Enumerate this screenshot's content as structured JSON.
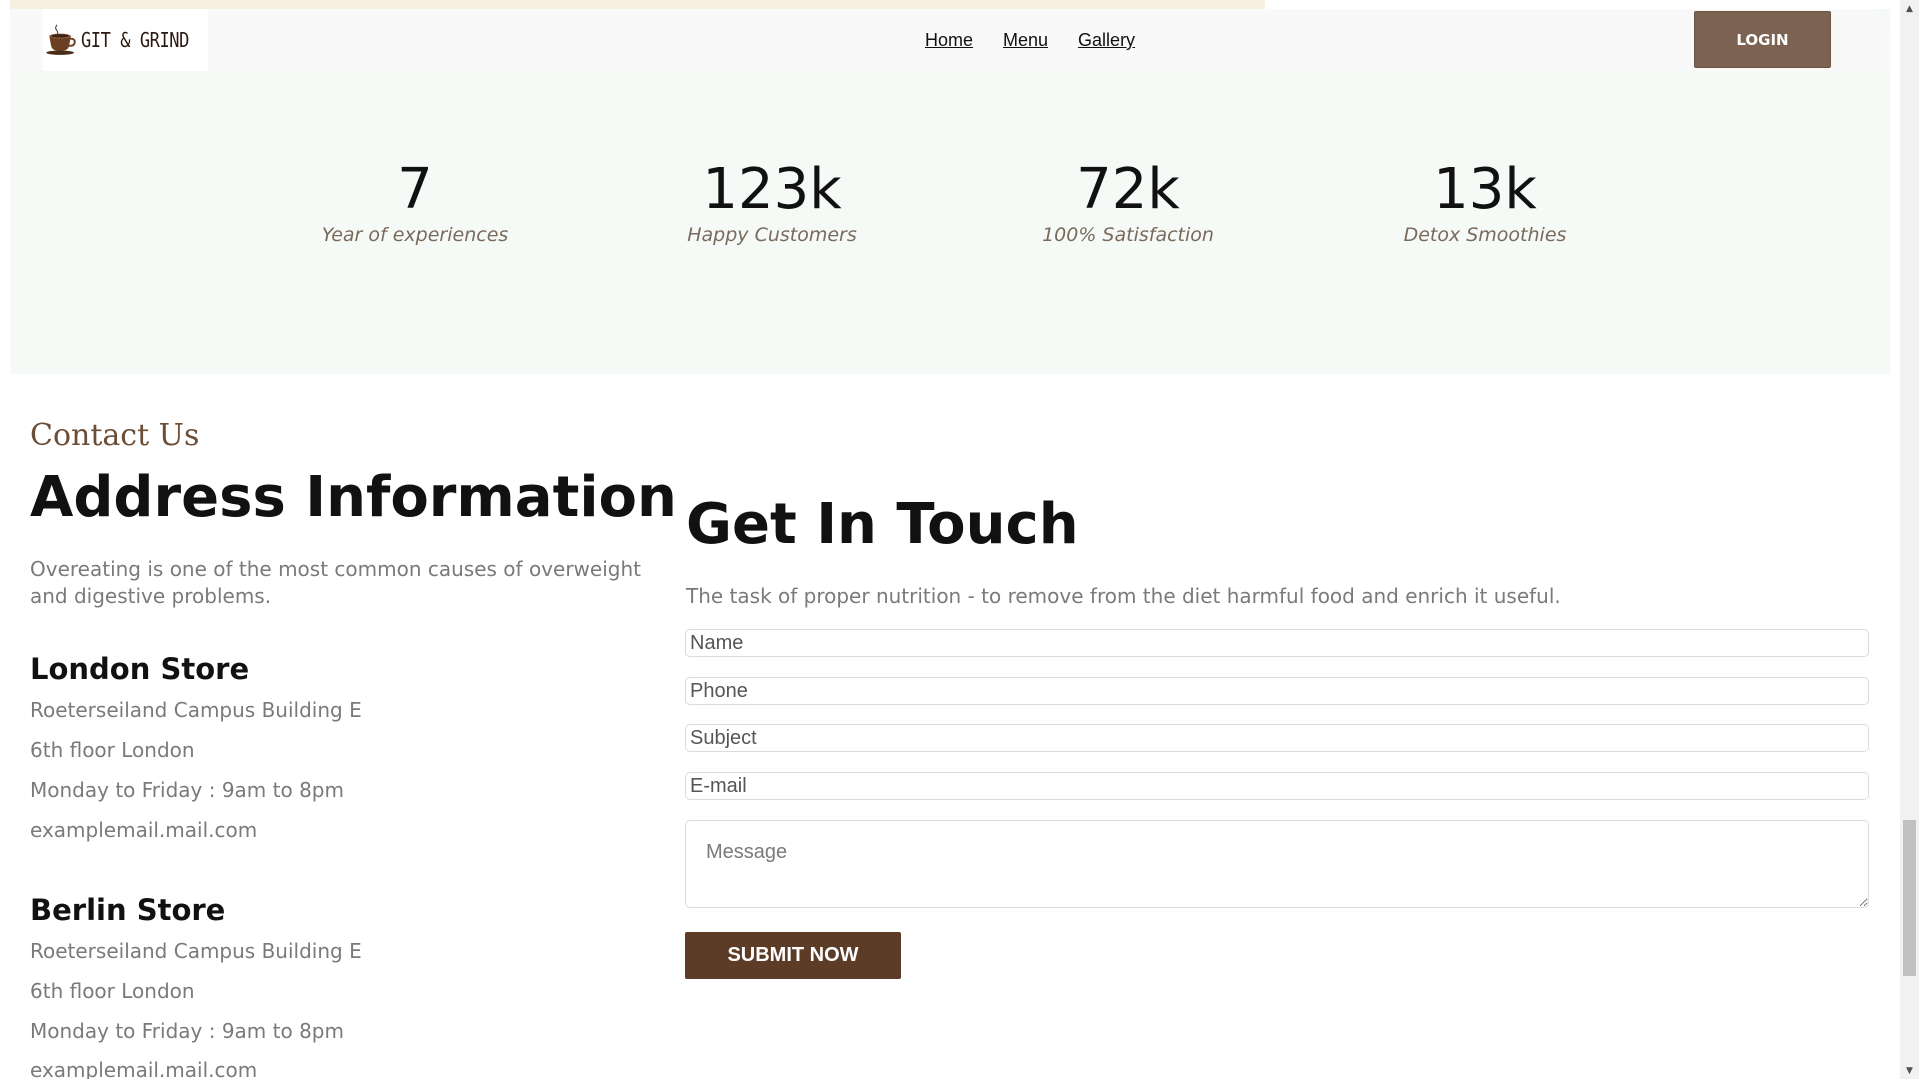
{
  "header": {
    "logo_text": "GIT & GRIND",
    "nav": [
      {
        "label": "Home"
      },
      {
        "label": "Menu"
      },
      {
        "label": "Gallery"
      }
    ],
    "login_label": "LOGIN"
  },
  "stats": [
    {
      "value": "7",
      "label": "Year of experiences"
    },
    {
      "value": "123k",
      "label": "Happy Customers"
    },
    {
      "value": "72k",
      "label": "100% Satisfaction"
    },
    {
      "value": "13k",
      "label": "Detox Smoothies"
    }
  ],
  "contact": {
    "eyebrow": "Contact Us",
    "title": "Address Information",
    "description": "Overeating is one of the most common causes of overweight and digestive problems.",
    "stores": [
      {
        "name": "London Store",
        "address1": "Roeterseiland Campus Building E",
        "address2": "6th floor London",
        "hours": "Monday to Friday : 9am to 8pm",
        "email": "examplemail.mail.com"
      },
      {
        "name": "Berlin Store",
        "address1": "Roeterseiland Campus Building E",
        "address2": "6th floor London",
        "hours": "Monday to Friday : 9am to 8pm",
        "email": "examplemail.mail.com"
      }
    ]
  },
  "form": {
    "title": "Get In Touch",
    "description": "The task of proper nutrition - to remove from the diet harmful food and enrich it useful.",
    "name_placeholder": "Name",
    "phone_placeholder": "Phone",
    "subject_placeholder": "Subject",
    "email_placeholder": "E-mail",
    "message_placeholder": "Message",
    "submit_label": "SUBMIT NOW"
  },
  "colors": {
    "brand_brown": "#7b6251",
    "submit_brown": "#5c3b27",
    "stats_bg": "#f5faf7",
    "eyebrow": "#6b4e37"
  }
}
